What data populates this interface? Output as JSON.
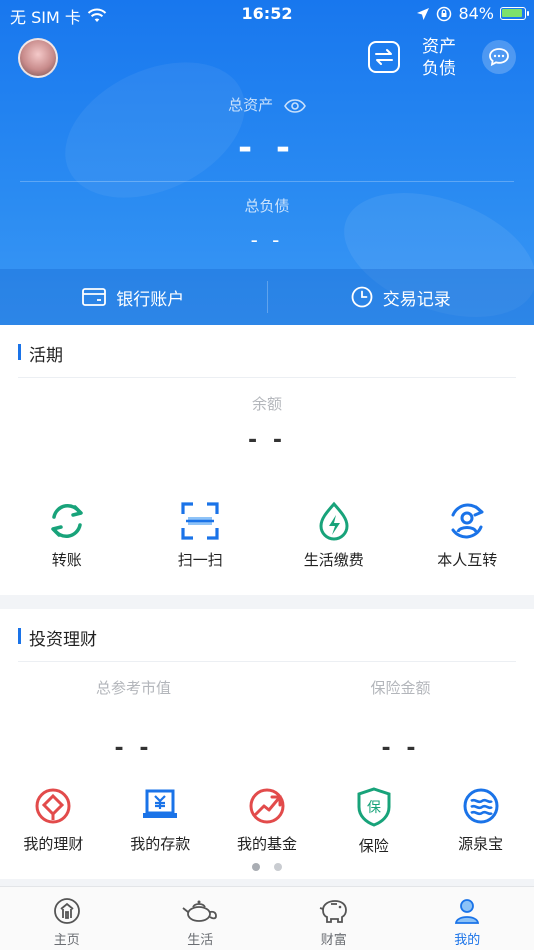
{
  "status_bar": {
    "carrier": "无 SIM 卡",
    "time": "16:52",
    "battery": "84%",
    "battery_level": 0.84
  },
  "header": {
    "asset_link_line1": "资产",
    "asset_link_line2": "负债"
  },
  "summary": {
    "total_assets_label": "总资产",
    "total_assets_value": "- -",
    "total_debt_label": "总负债",
    "total_debt_value": "- -"
  },
  "quick_bar": {
    "bank_account": "银行账户",
    "transactions": "交易记录"
  },
  "demand": {
    "title": "活期",
    "balance_label": "余额",
    "balance_value": "- -",
    "actions": [
      {
        "label": "转账",
        "icon": "transfer-icon"
      },
      {
        "label": "扫一扫",
        "icon": "scan-icon"
      },
      {
        "label": "生活缴费",
        "icon": "bill-pay-icon"
      },
      {
        "label": "本人互转",
        "icon": "self-transfer-icon"
      }
    ]
  },
  "investment": {
    "title": "投资理财",
    "market_value_label": "总参考市值",
    "market_value": "- -",
    "insurance_label": "保险金额",
    "insurance_value": "- -",
    "actions": [
      {
        "label": "我的理财",
        "icon": "wealth-icon"
      },
      {
        "label": "我的存款",
        "icon": "deposit-icon"
      },
      {
        "label": "我的基金",
        "icon": "fund-icon"
      },
      {
        "label": "保险",
        "icon": "insurance-icon",
        "icon_text": "保"
      },
      {
        "label": "源泉宝",
        "icon": "yuanquan-icon"
      }
    ]
  },
  "tabbar": [
    {
      "label": "主页",
      "icon": "home-icon"
    },
    {
      "label": "生活",
      "icon": "life-teapot-icon"
    },
    {
      "label": "财富",
      "icon": "piggy-bank-icon"
    },
    {
      "label": "我的",
      "icon": "profile-icon",
      "active": true
    }
  ],
  "colors": {
    "brand_blue": "#1a73e8",
    "green": "#18a37a",
    "red": "#e24b4b"
  }
}
